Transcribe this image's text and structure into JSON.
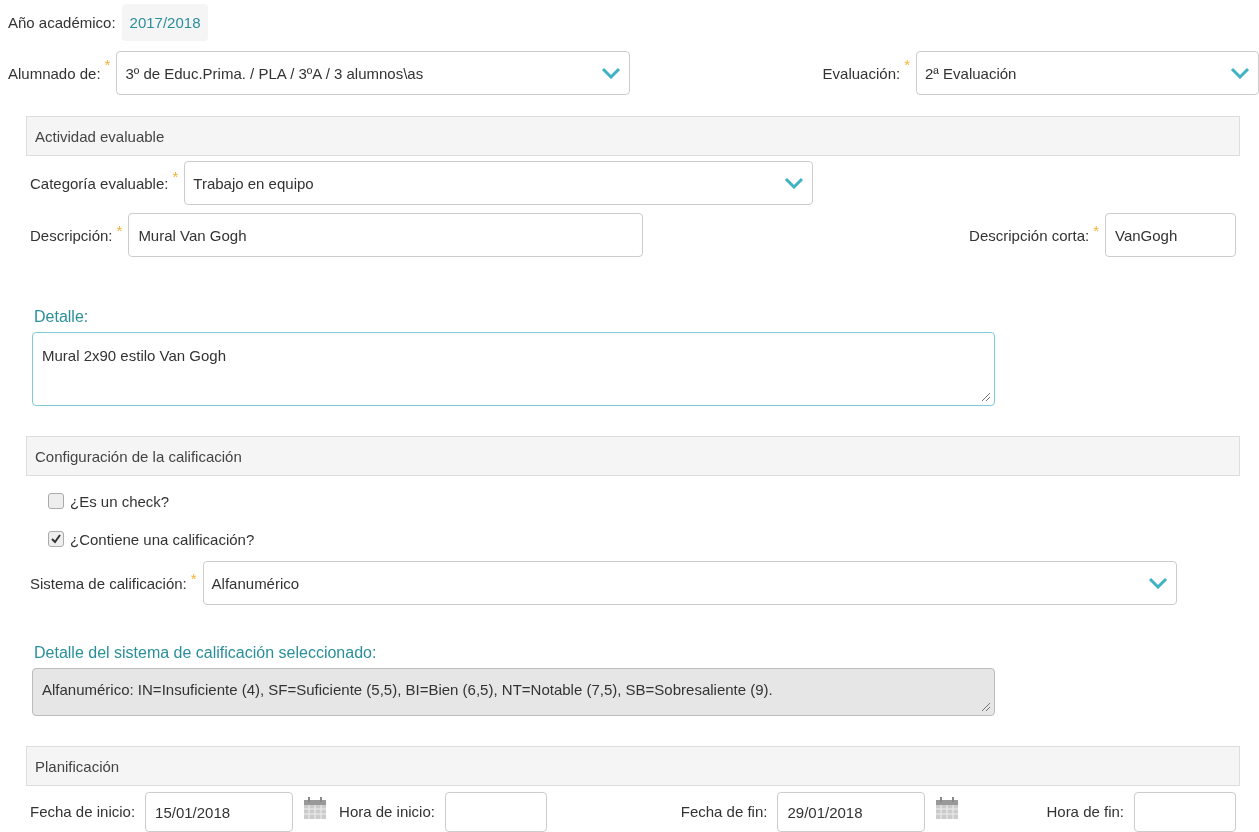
{
  "academic_year": {
    "label": "Año académico:",
    "value": "2017/2018"
  },
  "students": {
    "label": "Alumnado de:",
    "required_mark": "*",
    "value": "3º de Educ.Prima. / PLA / 3ºA / 3 alumnos\\as"
  },
  "evaluation": {
    "label": "Evaluación:",
    "required_mark": "*",
    "value": "2ª Evaluación"
  },
  "activity_section": {
    "title": "Actividad evaluable"
  },
  "category": {
    "label": "Categoría evaluable:",
    "required_mark": "*",
    "value": "Trabajo en equipo"
  },
  "description": {
    "label": "Descripción:",
    "required_mark": "*",
    "value": "Mural Van Gogh"
  },
  "short_description": {
    "label": "Descripción corta:",
    "required_mark": "*",
    "value": "VanGogh"
  },
  "detail": {
    "label": "Detalle:",
    "value": "Mural 2x90 estilo Van Gogh"
  },
  "grading_section": {
    "title": "Configuración de la calificación"
  },
  "checkboxes": [
    {
      "label": "¿Es un check?",
      "checked": false
    },
    {
      "label": "¿Contiene una calificación?",
      "checked": true
    }
  ],
  "grading_system": {
    "label": "Sistema de calificación:",
    "required_mark": "*",
    "value": "Alfanumérico"
  },
  "grading_detail": {
    "label": "Detalle del sistema de calificación seleccionado:",
    "value": "Alfanumérico: IN=Insuficiente (4), SF=Suficiente (5,5), BI=Bien (6,5), NT=Notable (7,5), SB=Sobresaliente (9)."
  },
  "planning_section": {
    "title": "Planificación"
  },
  "planning": [
    {
      "label": "Fecha de inicio:",
      "value": "15/01/2018",
      "kind": "date"
    },
    {
      "label": "Hora de inicio:",
      "kind": "time"
    },
    {
      "label": "Fecha de fin:",
      "value": "29/01/2018",
      "kind": "date"
    },
    {
      "label": "Hora de fin:",
      "kind": "time"
    }
  ]
}
